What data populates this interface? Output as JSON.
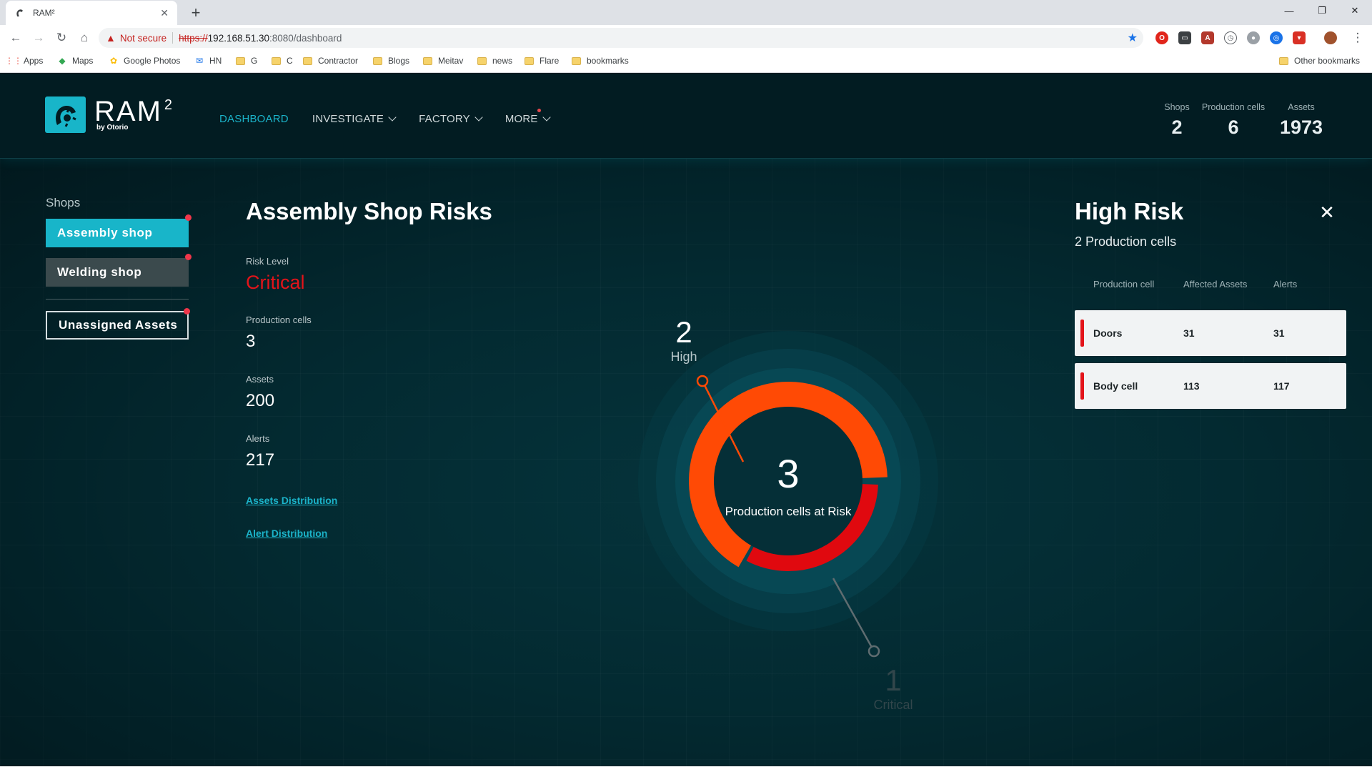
{
  "browser": {
    "tab_title": "RAM²",
    "url_warning": "Not secure",
    "url_protocol": "https://",
    "url_host": "192.168.51.30",
    "url_port_path": ":8080/dashboard",
    "bookmarks": [
      {
        "label": "Apps",
        "icon": "apps-grid-icon"
      },
      {
        "label": "Maps",
        "icon": "maps-icon"
      },
      {
        "label": "Google Photos",
        "icon": "photos-icon"
      },
      {
        "label": "HN",
        "icon": "mail-icon"
      },
      {
        "label": "G",
        "icon": "folder-icon"
      },
      {
        "label": "C",
        "icon": "folder-icon"
      },
      {
        "label": "Contractor",
        "icon": "folder-icon"
      },
      {
        "label": "Blogs",
        "icon": "folder-icon"
      },
      {
        "label": "Meitav",
        "icon": "folder-icon"
      },
      {
        "label": "news",
        "icon": "folder-icon"
      },
      {
        "label": "Flare",
        "icon": "folder-icon"
      },
      {
        "label": "bookmarks",
        "icon": "folder-icon"
      }
    ],
    "other_bookmarks": "Other bookmarks"
  },
  "app": {
    "logo": {
      "name": "RAM",
      "sup": "2",
      "byline": "by Otorio"
    },
    "nav": [
      {
        "label": "DASHBOARD",
        "active": true,
        "dropdown": false
      },
      {
        "label": "INVESTIGATE",
        "active": false,
        "dropdown": true
      },
      {
        "label": "FACTORY",
        "active": false,
        "dropdown": true
      },
      {
        "label": "MORE",
        "active": false,
        "dropdown": true,
        "notification": true
      }
    ],
    "stats": [
      {
        "label": "Shops",
        "value": "2"
      },
      {
        "label": "Production cells",
        "value": "6"
      },
      {
        "label": "Assets",
        "value": "1973"
      }
    ]
  },
  "sidebar": {
    "title": "Shops",
    "shops": [
      {
        "label": "Assembly shop",
        "selected": true,
        "alert": true
      },
      {
        "label": "Welding shop",
        "selected": false,
        "alert": true
      }
    ],
    "unassigned": {
      "label": "Unassigned Assets",
      "alert": true
    }
  },
  "overview": {
    "title": "Assembly Shop Risks",
    "risk_level_label": "Risk Level",
    "risk_level_value": "Critical",
    "production_cells_label": "Production cells",
    "production_cells_value": "3",
    "assets_label": "Assets",
    "assets_value": "200",
    "alerts_label": "Alerts",
    "alerts_value": "217",
    "links": [
      "Assets Distribution",
      "Alert Distribution"
    ]
  },
  "donut": {
    "center_value": "3",
    "center_label": "Production cells at Risk",
    "segments": [
      {
        "label": "High",
        "value": 2,
        "color": "#ff4a05"
      },
      {
        "label": "Critical",
        "value": 1,
        "color": "#e0090f"
      }
    ]
  },
  "high_risk_panel": {
    "title": "High Risk",
    "subtitle": "2 Production cells",
    "columns": [
      "Production cell",
      "Affected Assets",
      "Alerts"
    ],
    "rows": [
      {
        "cell": "Doors",
        "affected": "31",
        "alerts": "31"
      },
      {
        "cell": "Body cell",
        "affected": "113",
        "alerts": "117"
      }
    ]
  },
  "colors": {
    "accent": "#18b5c9",
    "critical": "#e3141a",
    "high": "#ff4a05",
    "background": "#032a31"
  }
}
